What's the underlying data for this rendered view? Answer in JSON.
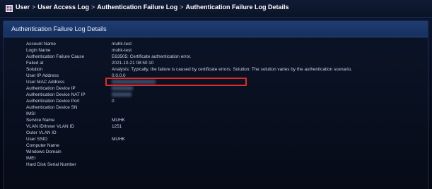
{
  "breadcrumb": {
    "items": [
      "User",
      "User Access Log",
      "Authentication Failure Log",
      "Authentication Failure Log Details"
    ],
    "separator": ">"
  },
  "panel": {
    "title": "Authentication Failure Log Details"
  },
  "details": [
    {
      "label": "Account Name",
      "value": "muhk-test"
    },
    {
      "label": "Login Name",
      "value": "muhk-test"
    },
    {
      "label": "Authentication Failure Cause",
      "value": "E63505: Certificate authentication error."
    },
    {
      "label": "Failed at",
      "value": "2021-10-21 08:50:10"
    },
    {
      "label": "Solution",
      "value": "Analysis: Typically, the failure is caused by certificate errors. Solution: The solution varies by the authentication scenario."
    },
    {
      "label": "User IP Address",
      "value": "0.0.0.0"
    },
    {
      "label": "User MAC Address",
      "value": ""
    },
    {
      "label": "Authentication Device IP",
      "value": ""
    },
    {
      "label": "Authentication Device NAT IP",
      "value": ""
    },
    {
      "label": "Authentication Device Port",
      "value": "0"
    },
    {
      "label": "Authentication Device SN",
      "value": ""
    },
    {
      "label": "IMSI",
      "value": ""
    },
    {
      "label": "Service Name",
      "value": "MUHK"
    },
    {
      "label": "VLAN ID/Inner VLAN ID",
      "value": "1251"
    },
    {
      "label": "Outer VLAN ID",
      "value": ""
    },
    {
      "label": "User SSID",
      "value": "MUHK"
    },
    {
      "label": "Computer Name",
      "value": ""
    },
    {
      "label": "Windows Domain",
      "value": ""
    },
    {
      "label": "IMEI",
      "value": ""
    },
    {
      "label": "Hard Disk Serial Number",
      "value": ""
    }
  ],
  "colors": {
    "highlight": "#e02b2b",
    "header": "#1f3c72"
  },
  "icons": {
    "home": "user-home-icon"
  }
}
